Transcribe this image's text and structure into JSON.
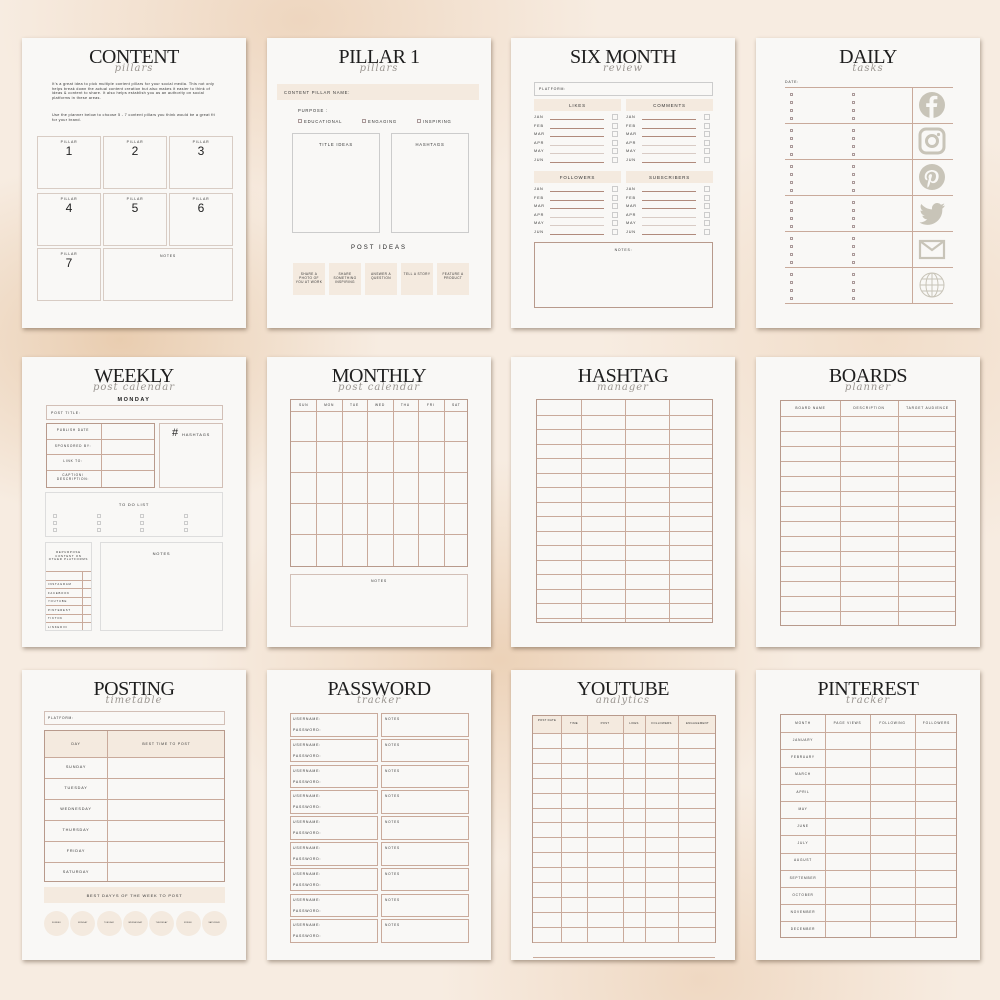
{
  "colors": {
    "accent_line": "#c9aa9b",
    "beige_fill": "#f4eadf",
    "icon_gray": "#c8c4b8",
    "page": "#f9f8f6"
  },
  "content": {
    "title": "CONTENT",
    "subtitle": "pillars",
    "paragraph1": "It's a great idea to pick multiple content pillars for your social media. This not only helps break down the actual content creation but also makes it easier to think of ideas & content to share. It also helps establish you as an authority on social platforms in these areas.",
    "paragraph2": "Use the planner below to choose 5 - 7 content pillars you think would be a great fit for your brand.",
    "pillar_label": "PILLAR",
    "pillars": [
      "1",
      "2",
      "3",
      "4",
      "5",
      "6",
      "7"
    ],
    "notes_label": "NOTES"
  },
  "pillar1": {
    "title": "PILLAR 1",
    "subtitle": "pillars",
    "name_label": "CONTENT PILLAR NAME:",
    "purpose_label": "PURPOSE :",
    "purposes": [
      "EDUCATIONAL",
      "ENGAGING",
      "INSPIRING"
    ],
    "title_ideas": "TITLE IDEAS",
    "hashtags": "HASHTAGS",
    "post_ideas": "POST IDEAS",
    "ideas": [
      "SHARE A PHOTO OF YOU AT WORK",
      "SHARE SOMETHING INSPIRING",
      "ANSWER A QUESTION",
      "TELL A STORY",
      "FEATURE A PRODUCT"
    ]
  },
  "sixmonth": {
    "title": "SIX MONTH",
    "subtitle": "review",
    "platform_label": "PLATFORM:",
    "sections": [
      "LIKES",
      "COMMENTS",
      "FOLLOWERS",
      "SUBSCRIBERS"
    ],
    "months": [
      "JAN",
      "FEB",
      "MAR",
      "APR",
      "MAY",
      "JUN"
    ],
    "notes_label": "NOTES:"
  },
  "daily": {
    "title": "DAILY",
    "subtitle": "tasks",
    "date_label": "DATE:",
    "icons": [
      "facebook-icon",
      "instagram-icon",
      "pinterest-icon",
      "twitter-icon",
      "mail-icon",
      "globe-icon"
    ]
  },
  "weekly": {
    "title": "WEEKLY",
    "subtitle": "post calendar",
    "day": "MONDAY",
    "post_title_label": "POST TITLE:",
    "fields": [
      "PUBLISH DATE",
      "SPONSORED BY:",
      "LINK TO:",
      "CAPTION/ DESCRIPTION:"
    ],
    "hashtags": "HASHTAGS",
    "todo": "TO DO LIST",
    "repurpose": "REPURPOSE CONTENT ON OTHER PLATFORMS",
    "platforms": [
      "INSTAGRAM",
      "FACEBOOK",
      "YOUTUBE",
      "PINTEREST",
      "TIKTOK",
      "LINKEDIN"
    ],
    "notes": "NOTES"
  },
  "monthly": {
    "title": "MONTHLY",
    "subtitle": "post calendar",
    "days": [
      "SUN",
      "MON",
      "TUE",
      "WED",
      "THU",
      "FRI",
      "SAT"
    ],
    "notes": "NOTES"
  },
  "hashtag": {
    "title": "HASHTAG",
    "subtitle": "manager"
  },
  "boards": {
    "title": "BOARDS",
    "subtitle": "planner",
    "columns": [
      "BOARD NAME",
      "DESCRIPTION",
      "TARGET AUDIENCE"
    ]
  },
  "posting": {
    "title": "POSTING",
    "subtitle": "timetable",
    "platform_label": "PLATFORM:",
    "col_day": "DAY",
    "col_time": "BEST TIME TO POST",
    "days": [
      "SUNDAY",
      "TUESDAY",
      "WEDNESDAY",
      "THURSDAY",
      "FRIDAY",
      "SATURDAY"
    ],
    "best_days": "BEST DAYYS OF THE WEEK TO POST",
    "circles": [
      "SUNDAY",
      "MONDAY",
      "TUESDAY",
      "WEDNESDAY",
      "THURSDAY",
      "FRIDAY",
      "SATURDAY"
    ]
  },
  "password": {
    "title": "PASSWORD",
    "subtitle": "tracker",
    "username": "USERNAME:",
    "password": "PASSWORD:",
    "notes": "NOTES"
  },
  "youtube": {
    "title": "YOUTUBE",
    "subtitle": "analytics",
    "columns": [
      "POST DATE",
      "TIME",
      "POST",
      "LIKES",
      "FOLLOWERS",
      "ENGAGEMENT"
    ]
  },
  "pinterest": {
    "title": "PINTEREST",
    "subtitle": "tracker",
    "columns": [
      "MONTH",
      "PAGE VIEWS",
      "FOLLOWING",
      "FOLLOWERS"
    ],
    "months": [
      "JANUARY",
      "FEBRUARY",
      "MARCH",
      "APRIL",
      "MAY",
      "JUNE",
      "JULY",
      "AUGUST",
      "SEPTEMBER",
      "OCTOBER",
      "NOVEMBER",
      "DECEMBER"
    ]
  }
}
